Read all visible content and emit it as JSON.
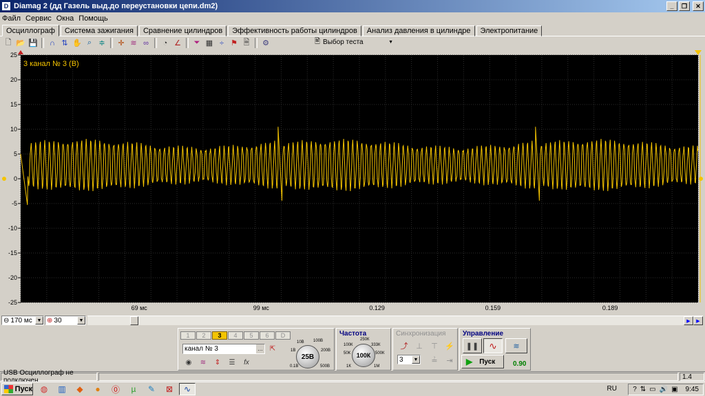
{
  "window": {
    "title": "Diamag 2 (дд Газель выд.до переустановки цепи.dm2)"
  },
  "menu": [
    "Файл",
    "Сервис",
    "Окна",
    "Помощь"
  ],
  "tabs": [
    {
      "label": "Осциллограф",
      "active": true
    },
    {
      "label": "Система зажигания",
      "active": false
    },
    {
      "label": "Сравнение цилиндров",
      "active": false
    },
    {
      "label": "Эффективность работы цилиндров",
      "active": false
    },
    {
      "label": "Анализ давления в цилиндре",
      "active": false
    },
    {
      "label": "Электропитание",
      "active": false
    }
  ],
  "toolbar": {
    "test_select_label": "Выбор теста"
  },
  "oscilloscope": {
    "channel_label": "3 канал № 3 (В)",
    "colors": {
      "trace": "#f5c400",
      "background": "#000000",
      "grid": "#2e2e2e",
      "axis_text": "#000000"
    }
  },
  "chart_data": {
    "type": "line",
    "ylim": [
      -25,
      25
    ],
    "y_ticks": [
      25,
      20,
      15,
      10,
      5,
      0,
      -5,
      -10,
      -15,
      -20,
      -25
    ],
    "x_tick_labels": [
      "69 мс",
      "99 мс",
      "0.129",
      "0.159",
      "0.189"
    ],
    "series": [
      {
        "name": "3 канал № 3 (В)",
        "signal_band": [
          -2,
          7.5
        ],
        "oscillation_periods_per_segment": 56,
        "spike_peak": 10.5,
        "spike_trough": -5.5,
        "segments_x_fraction": [
          [
            0.0,
            0.38
          ],
          [
            0.38,
            0.76
          ],
          [
            0.76,
            1.0
          ]
        ]
      }
    ]
  },
  "controls": {
    "timebase_value": "170 мс",
    "zoom_value": "30",
    "channel_buttons": [
      "1",
      "2",
      "3",
      "4",
      "5",
      "6",
      "D"
    ],
    "active_channel": "3",
    "channel_name": "канал № 3",
    "voltage_knob": {
      "value": "25В",
      "ticks": [
        "10В",
        "100В",
        "1В",
        "200В",
        "0.1В",
        "500В"
      ]
    },
    "frequency": {
      "title": "Частота",
      "value": "100К",
      "ticks": [
        "250К",
        "100К",
        "333К",
        "50К",
        "500К",
        "1К",
        "1М"
      ]
    },
    "sync": {
      "title": "Синхронизация",
      "value": "3"
    },
    "management": {
      "title": "Управление",
      "start_label": "Пуск",
      "value": "0.90"
    }
  },
  "status": {
    "left": "USB Осциллограф не подключен",
    "right": "1.4"
  },
  "taskbar": {
    "start_label": "Пуск",
    "lang": "RU",
    "time": "9:45"
  }
}
